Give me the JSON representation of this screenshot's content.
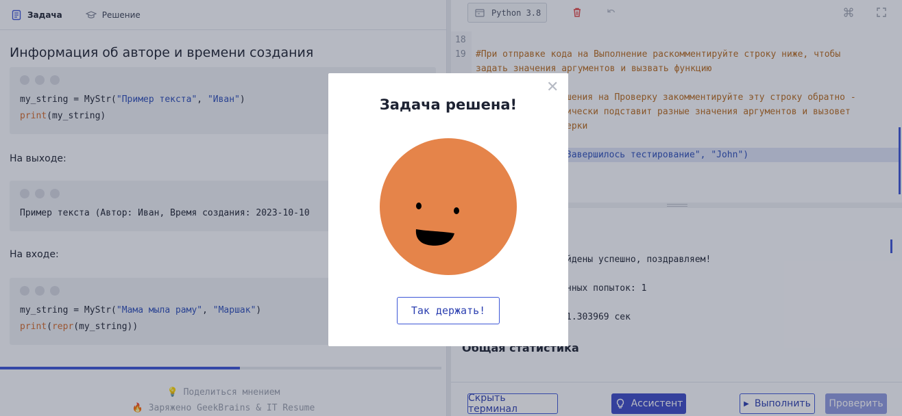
{
  "left": {
    "tabs": [
      {
        "label": "Задача",
        "icon": "document-icon"
      },
      {
        "label": "Решение",
        "icon": "graduation-cap-icon"
      }
    ],
    "title": "Информация об авторе и времени создания",
    "example1": {
      "line1": {
        "pre": "my_string = MyStr(",
        "s1": "\"Пример текста\"",
        "mid": ", ",
        "s2": "\"Иван\"",
        "post": ")"
      },
      "line2": {
        "fn": "print",
        "rest": "(my_string)"
      }
    },
    "output_label": "На выходе:",
    "output_line": "Пример текста (Автор: Иван, Время создания: 2023-10-10",
    "input_label": "На входе:",
    "example2": {
      "line1": {
        "pre": "my_string = MyStr(",
        "s1": "\"Мама мыла раму\"",
        "mid": ", ",
        "s2": "\"Маршак\"",
        "post": ")"
      },
      "line2": {
        "fn1": "print",
        "mid": "(",
        "fn2": "repr",
        "rest": "(my_string))"
      }
    },
    "footer": {
      "feedback": "Поделиться мнением",
      "powered": "Заряжено GeekBrains & IT Resume"
    }
  },
  "right": {
    "language": "Python 3.8",
    "editor": {
      "line_numbers": [
        "18",
        "19"
      ],
      "lines": [
        "#При отправке кода на Выполнение раскомментируйте строку ниже, чтобы",
        "задать значения аргументов и вызвать функцию",
        "",
        "шения на Проверку закомментируйте эту строку обратно -",
        "ически подставит разные значения аргументов и вызовет",
        "ерки",
        "",
        "Завершилось тестирование\", \"John\")"
      ]
    },
    "terminal": {
      "lines": [
        "йдены успешно, поздравляем!",
        "нных попыток: 1",
        "1.303969 сек"
      ],
      "stats_heading": "Общая статистика"
    },
    "buttons": {
      "hide_terminal": "Скрыть терминал",
      "assistant": "Ассистент",
      "run": "Выполнить",
      "check": "Проверить"
    }
  },
  "modal": {
    "title": "Задача решена!",
    "button": "Так держать!",
    "smiley_color": "#e5844a"
  },
  "colors": {
    "accent": "#3b55d6",
    "code_string": "#2b4db8",
    "code_function": "#d26a2b"
  }
}
